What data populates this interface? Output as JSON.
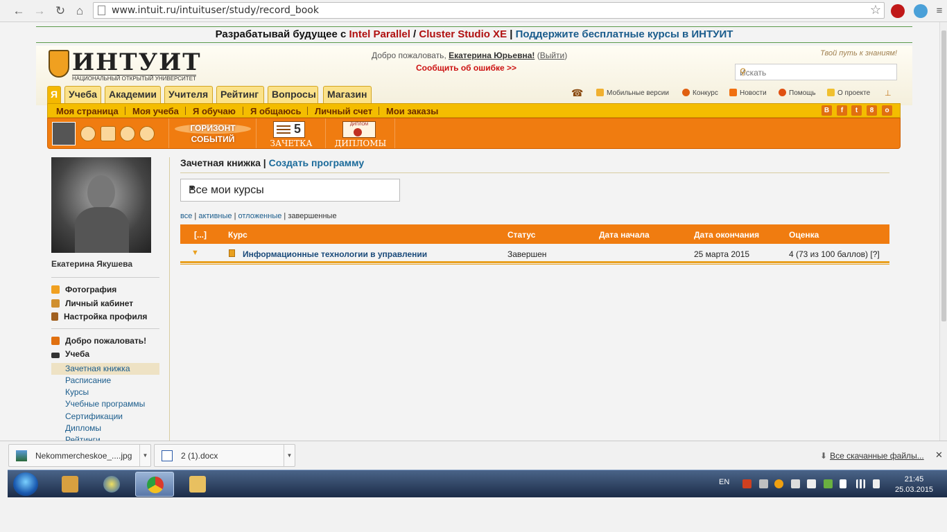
{
  "browser": {
    "url": "www.intuit.ru/intuituser/study/record_book"
  },
  "promo": {
    "part1": "Разрабатывай будущее с ",
    "part2": "Intel Parallel",
    "part3": " / ",
    "part4": "Cluster Studio XE",
    "part5": " | ",
    "part6": "Поддержите бесплатные курсы в ИНТУИТ"
  },
  "header": {
    "logo_word": "ИНТУИТ",
    "logo_sub": "НАЦИОНАЛЬНЫЙ ОТКРЫТЫЙ УНИВЕРСИТЕТ",
    "welcome_prefix": "Добро пожаловать, ",
    "user_full": "Екатерина Юрьевна!",
    "logout_open": " (",
    "logout": "Выйти",
    "logout_close": ")",
    "report_error": "Сообщить об ошибке >>",
    "motto": "Твой путь к знаниям!",
    "search_placeholder": "Искать"
  },
  "tabs": [
    "Я",
    "Учеба",
    "Академии",
    "Учителя",
    "Рейтинг",
    "Вопросы",
    "Магазин"
  ],
  "top_links": [
    "Мобильные версии",
    "Конкурс",
    "Новости",
    "Помощь",
    "О проекте"
  ],
  "subnav": [
    "Моя страница",
    "Моя учеба",
    "Я обучаю",
    "Я общаюсь",
    "Личный счет",
    "Мои заказы"
  ],
  "social": [
    "В",
    "f",
    "t",
    "8",
    "о"
  ],
  "banners": {
    "horizon_1": "ГОРИЗОНТ",
    "horizon_2": "СОБЫТИЙ",
    "zachetka_grade": "5",
    "zachetka": "ЗАЧЕТКА",
    "diploma_badge": "ДИПЛОМ",
    "diplomas": "ДИПЛОМЫ"
  },
  "sidebar": {
    "user_name": "Екатерина Якушева",
    "profile_items": [
      "Фотография",
      "Личный кабинет",
      "Настройка профиля"
    ],
    "welcome_item": "Добро пожаловать!",
    "study_item": "Учеба",
    "study_sub": [
      "Зачетная книжка",
      "Расписание",
      "Курсы",
      "Учебные программы",
      "Сертификации",
      "Дипломы",
      "Рейтинги"
    ]
  },
  "main": {
    "title": "Зачетная книжка",
    "title_sep": " | ",
    "create_program": "Создать программу",
    "select_value": "Все мои курсы",
    "filters": {
      "all": "все",
      "active": "активные",
      "postponed": "отложенные",
      "completed": "завершенные"
    },
    "table": {
      "headers": [
        "[...]",
        "Курс",
        "Статус",
        "Дата начала",
        "Дата окончания",
        "Оценка"
      ],
      "rows": [
        {
          "course": "Информационные технологии в управлении",
          "status": "Завершен",
          "start": "",
          "end": "25 марта 2015",
          "grade": "4 (73 из 100 баллов) [?]"
        }
      ]
    }
  },
  "downloads": {
    "items": [
      "Nekommercheskoe_....jpg",
      "2 (1).docx"
    ],
    "all": "Все скачанные файлы..."
  },
  "taskbar": {
    "lang": "EN",
    "time": "21:45",
    "date": "25.03.2015"
  },
  "colors": {
    "orange": "#f07c10",
    "yellow": "#f4bd00",
    "link": "#1a5c8c"
  }
}
